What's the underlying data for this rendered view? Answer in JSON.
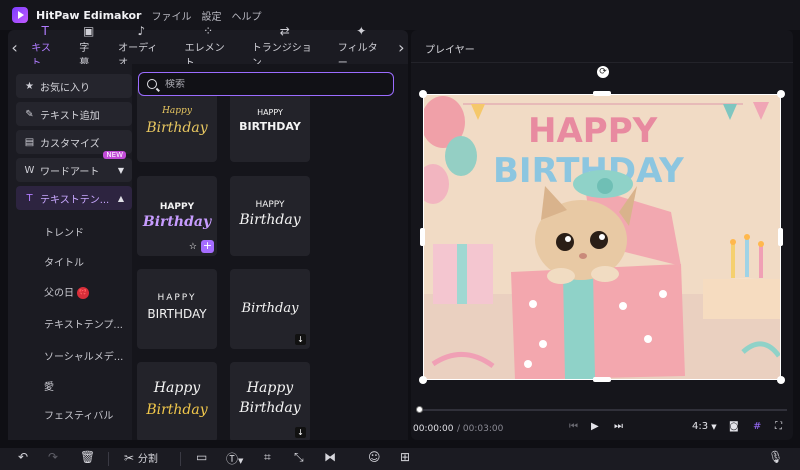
{
  "app": {
    "title": "HitPaw Edimakor",
    "menu": [
      "ファイル",
      "設定",
      "ヘルプ"
    ]
  },
  "tabs": {
    "left_arrow": "‹",
    "right_arrow": "›",
    "items": [
      {
        "label": "キスト",
        "icon": "text-icon",
        "active": true
      },
      {
        "label": "字幕",
        "icon": "subtitle-icon"
      },
      {
        "label": "オーディオ",
        "icon": "music-note-icon"
      },
      {
        "label": "エレメント",
        "icon": "element-icon"
      },
      {
        "label": "トランジション",
        "icon": "transition-icon"
      },
      {
        "label": "フィルター",
        "icon": "filter-icon"
      }
    ]
  },
  "sidebar": {
    "items": [
      {
        "label": "お気に入り",
        "icon": "star-icon"
      },
      {
        "label": "テキスト追加",
        "icon": "text-add-icon"
      },
      {
        "label": "カスタマイズ",
        "icon": "customize-icon"
      },
      {
        "label": "ワードアート",
        "icon": "wordart-icon",
        "badge": "NEW"
      },
      {
        "label": "テキストテン...",
        "icon": "template-icon",
        "active": true
      }
    ],
    "subitems": [
      "トレンド",
      "タイトル",
      "父の日",
      "テキストテンプ...",
      "ソーシャルメデ...",
      "愛",
      "フェスティバル"
    ],
    "fathers_day_badge": "🎀"
  },
  "search": {
    "placeholder": "検索"
  },
  "templates": [
    {
      "line1": "Happy",
      "line2": "Birthday",
      "style": "gold-cursive"
    },
    {
      "line1": "HAPPY",
      "line2": "BIRTHDAY",
      "style": "white-bold"
    },
    {
      "line1": "HAPPY",
      "line2": "Birthday",
      "style": "purple-bold"
    },
    {
      "line1": "HAPPY",
      "line2": "Birthday",
      "style": "white-script"
    },
    {
      "line1": "HAPPY",
      "line2": "BIRTHDAY",
      "style": "white-thin"
    },
    {
      "line1": "",
      "line2": "Birthday",
      "style": "grey-script"
    },
    {
      "line1": "Happy",
      "line2": "Birthday",
      "style": "yellow-script"
    },
    {
      "line1": "Happy",
      "line2": "Birthday",
      "style": "white-gold-script"
    }
  ],
  "player": {
    "title": "プレイヤー",
    "banner_line1": "HAPPY",
    "banner_line2": "BIRTHDAY",
    "time_current": "00:00:00",
    "time_total": "/ 00:03:00",
    "aspect": "4:3",
    "progress": 0.0
  },
  "toolbar": {
    "split_label": "分割"
  },
  "colors": {
    "accent": "#9b6cff",
    "background": "#0f0f14",
    "panel": "#1b1b22"
  }
}
